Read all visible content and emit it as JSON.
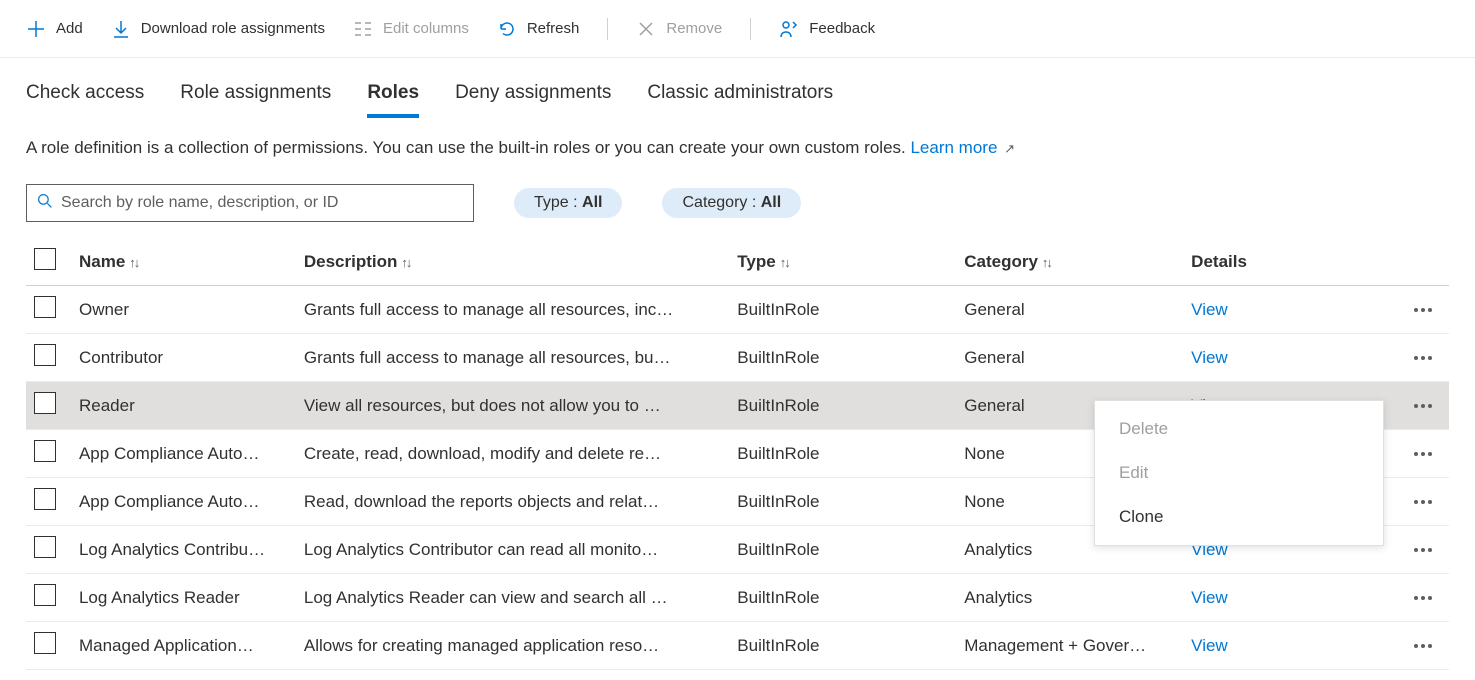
{
  "toolbar": {
    "add": "Add",
    "download": "Download role assignments",
    "edit_columns": "Edit columns",
    "refresh": "Refresh",
    "remove": "Remove",
    "feedback": "Feedback"
  },
  "tabs": [
    {
      "label": "Check access",
      "active": false
    },
    {
      "label": "Role assignments",
      "active": false
    },
    {
      "label": "Roles",
      "active": true
    },
    {
      "label": "Deny assignments",
      "active": false
    },
    {
      "label": "Classic administrators",
      "active": false
    }
  ],
  "description_text": "A role definition is a collection of permissions. You can use the built-in roles or you can create your own custom roles. ",
  "learn_more": "Learn more",
  "search": {
    "placeholder": "Search by role name, description, or ID"
  },
  "filters": {
    "type_label": "Type : ",
    "type_value": "All",
    "category_label": "Category : ",
    "category_value": "All"
  },
  "columns": {
    "name": "Name",
    "description": "Description",
    "type": "Type",
    "category": "Category",
    "details": "Details"
  },
  "view_label": "View",
  "rows": [
    {
      "name": "Owner",
      "desc": "Grants full access to manage all resources, inc…",
      "type": "BuiltInRole",
      "category": "General",
      "highlight": false
    },
    {
      "name": "Contributor",
      "desc": "Grants full access to manage all resources, bu…",
      "type": "BuiltInRole",
      "category": "General",
      "highlight": false
    },
    {
      "name": "Reader",
      "desc": "View all resources, but does not allow you to …",
      "type": "BuiltInRole",
      "category": "General",
      "highlight": true
    },
    {
      "name": "App Compliance Auto…",
      "desc": "Create, read, download, modify and delete re…",
      "type": "BuiltInRole",
      "category": "None",
      "highlight": false
    },
    {
      "name": "App Compliance Auto…",
      "desc": "Read, download the reports objects and relat…",
      "type": "BuiltInRole",
      "category": "None",
      "highlight": false
    },
    {
      "name": "Log Analytics Contribu…",
      "desc": "Log Analytics Contributor can read all monito…",
      "type": "BuiltInRole",
      "category": "Analytics",
      "highlight": false
    },
    {
      "name": "Log Analytics Reader",
      "desc": "Log Analytics Reader can view and search all …",
      "type": "BuiltInRole",
      "category": "Analytics",
      "highlight": false
    },
    {
      "name": "Managed Application…",
      "desc": "Allows for creating managed application reso…",
      "type": "BuiltInRole",
      "category": "Management + Gover…",
      "highlight": false
    }
  ],
  "context_menu": {
    "delete": "Delete",
    "edit": "Edit",
    "clone": "Clone"
  }
}
